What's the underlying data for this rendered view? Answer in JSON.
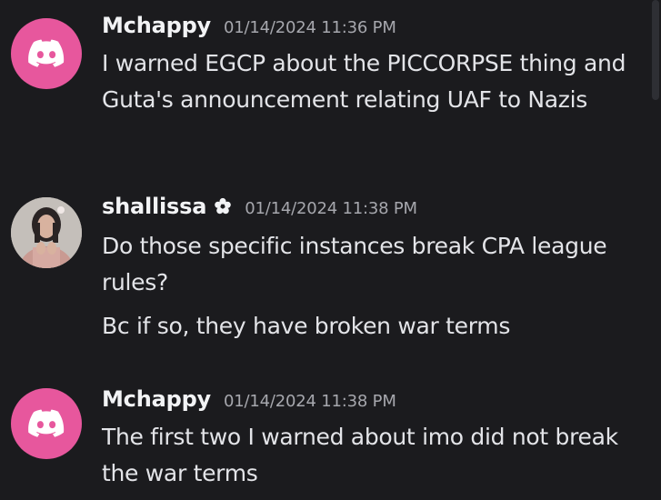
{
  "messages": [
    {
      "author": "Mchappy",
      "avatar": "discord-logo-icon",
      "avatar_color": "#e7579d",
      "timestamp": "01/14/2024 11:36 PM",
      "lines": [
        "I warned EGCP about the PICCORPSE thing and Guta's announcement relating UAF to Nazis"
      ]
    },
    {
      "author": "shallissa",
      "avatar": "user-photo",
      "badge_icon": "flower-icon",
      "timestamp": "01/14/2024 11:38 PM",
      "lines": [
        "Do those specific instances break CPA league rules?",
        "Bc if so, they have broken war terms"
      ]
    },
    {
      "author": "Mchappy",
      "avatar": "discord-logo-icon",
      "avatar_color": "#e7579d",
      "timestamp": "01/14/2024 11:38 PM",
      "lines": [
        "The first two I warned about imo did not break the war terms"
      ]
    }
  ]
}
